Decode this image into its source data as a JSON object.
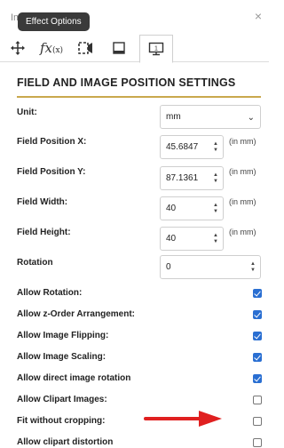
{
  "window": {
    "title": "Im",
    "close_glyph": "×"
  },
  "tooltip": {
    "text": "Effect Options"
  },
  "toolbar": {
    "buttons": [
      {
        "icon": "move-icon"
      },
      {
        "icon": "function-icon",
        "label": "fx"
      },
      {
        "icon": "crop-icon"
      },
      {
        "icon": "layers-icon"
      },
      {
        "icon": "monitor-icon",
        "label": "1"
      }
    ]
  },
  "panel": {
    "heading": "FIELD AND IMAGE POSITION SETTINGS"
  },
  "fields": {
    "unit": {
      "label": "Unit:",
      "value": "mm"
    },
    "pos_x": {
      "label": "Field Position X:",
      "value": "45.6847",
      "unit_note": "(in mm)"
    },
    "pos_y": {
      "label": "Field Position Y:",
      "value": "87.1361",
      "unit_note": "(in mm)"
    },
    "width": {
      "label": "Field Width:",
      "value": "40",
      "unit_note": "(in mm)"
    },
    "height": {
      "label": "Field Height:",
      "value": "40",
      "unit_note": "(in mm)"
    },
    "rotation": {
      "label": "Rotation",
      "value": "0"
    }
  },
  "checkboxes": [
    {
      "label": "Allow Rotation:",
      "checked": true
    },
    {
      "label": "Allow z-Order Arrangement:",
      "checked": true
    },
    {
      "label": "Allow Image Flipping:",
      "checked": true
    },
    {
      "label": "Allow Image Scaling:",
      "checked": true
    },
    {
      "label": "Allow direct image rotation",
      "checked": true
    },
    {
      "label": "Allow Clipart Images:",
      "checked": false
    },
    {
      "label": "Fit without cropping:",
      "checked": false
    },
    {
      "label": "Allow clipart distortion",
      "checked": false
    }
  ],
  "colors": {
    "accent": "#c9a84d",
    "checkbox": "#2a6fd2",
    "arrow": "#e02020"
  }
}
